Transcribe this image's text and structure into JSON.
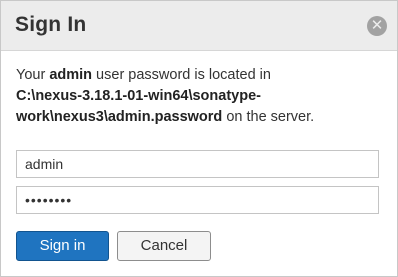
{
  "dialog": {
    "title": "Sign In",
    "close_icon": "close-icon",
    "message": {
      "prefix": "Your ",
      "user": "admin",
      "middle": " user password is located in",
      "path": "C:\\nexus-3.18.1-01-win64\\sonatype-work\\nexus3\\admin.password",
      "suffix": " on the server."
    },
    "username_value": "admin",
    "password_value": "••••••••",
    "signin_label": "Sign in",
    "cancel_label": "Cancel"
  },
  "colors": {
    "primary_button": "#1f74c0",
    "header_bg": "#ececec"
  }
}
